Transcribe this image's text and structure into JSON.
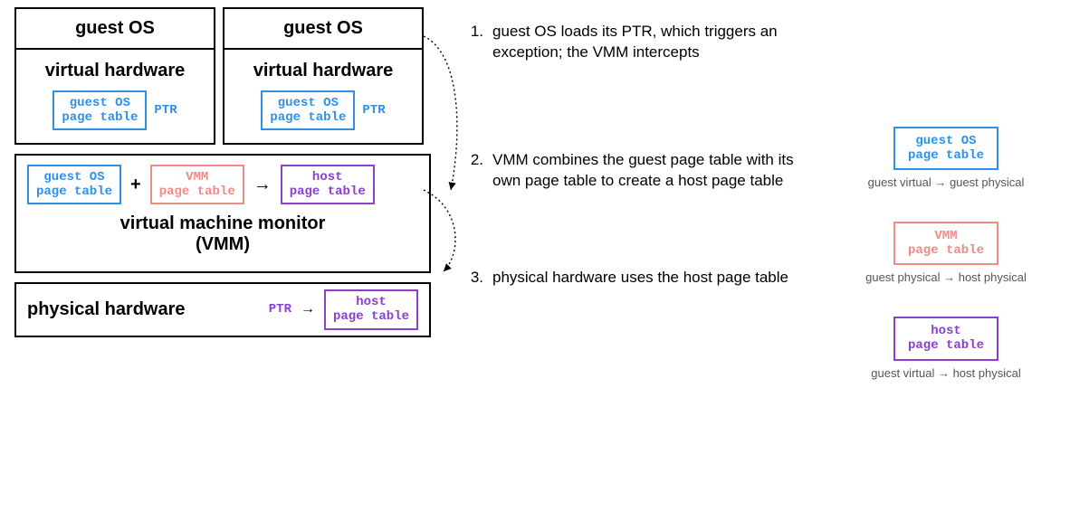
{
  "left": {
    "vm1": {
      "title": "guest OS",
      "vh": "virtual hardware",
      "pt": "guest OS\npage table",
      "ptr": "PTR"
    },
    "vm2": {
      "title": "guest OS",
      "vh": "virtual hardware",
      "pt": "guest OS\npage table",
      "ptr": "PTR"
    },
    "vmm": {
      "guest_pt": "guest OS\npage table",
      "plus": "+",
      "vmm_pt": "VMM\npage table",
      "arrow": "→",
      "host_pt": "host\npage table",
      "label": "virtual machine monitor\n(VMM)"
    },
    "phys": {
      "label": "physical hardware",
      "ptr": "PTR",
      "arrow": "→",
      "host_pt": "host\npage table"
    }
  },
  "steps": {
    "s1": {
      "num": "1.",
      "text": "guest OS loads its PTR, which triggers an exception; the VMM intercepts"
    },
    "s2": {
      "num": "2.",
      "text": "VMM combines the guest page table with its own page table to create a host page table"
    },
    "s3": {
      "num": "3.",
      "text": "physical hardware uses the host page table"
    }
  },
  "legend": {
    "guest": {
      "box": "guest OS\npage table",
      "caption": "guest virtual → guest physical"
    },
    "vmm": {
      "box": "VMM\npage table",
      "caption": "guest physical → host physical"
    },
    "host": {
      "box": "host\npage table",
      "caption": "guest virtual → host physical"
    }
  }
}
